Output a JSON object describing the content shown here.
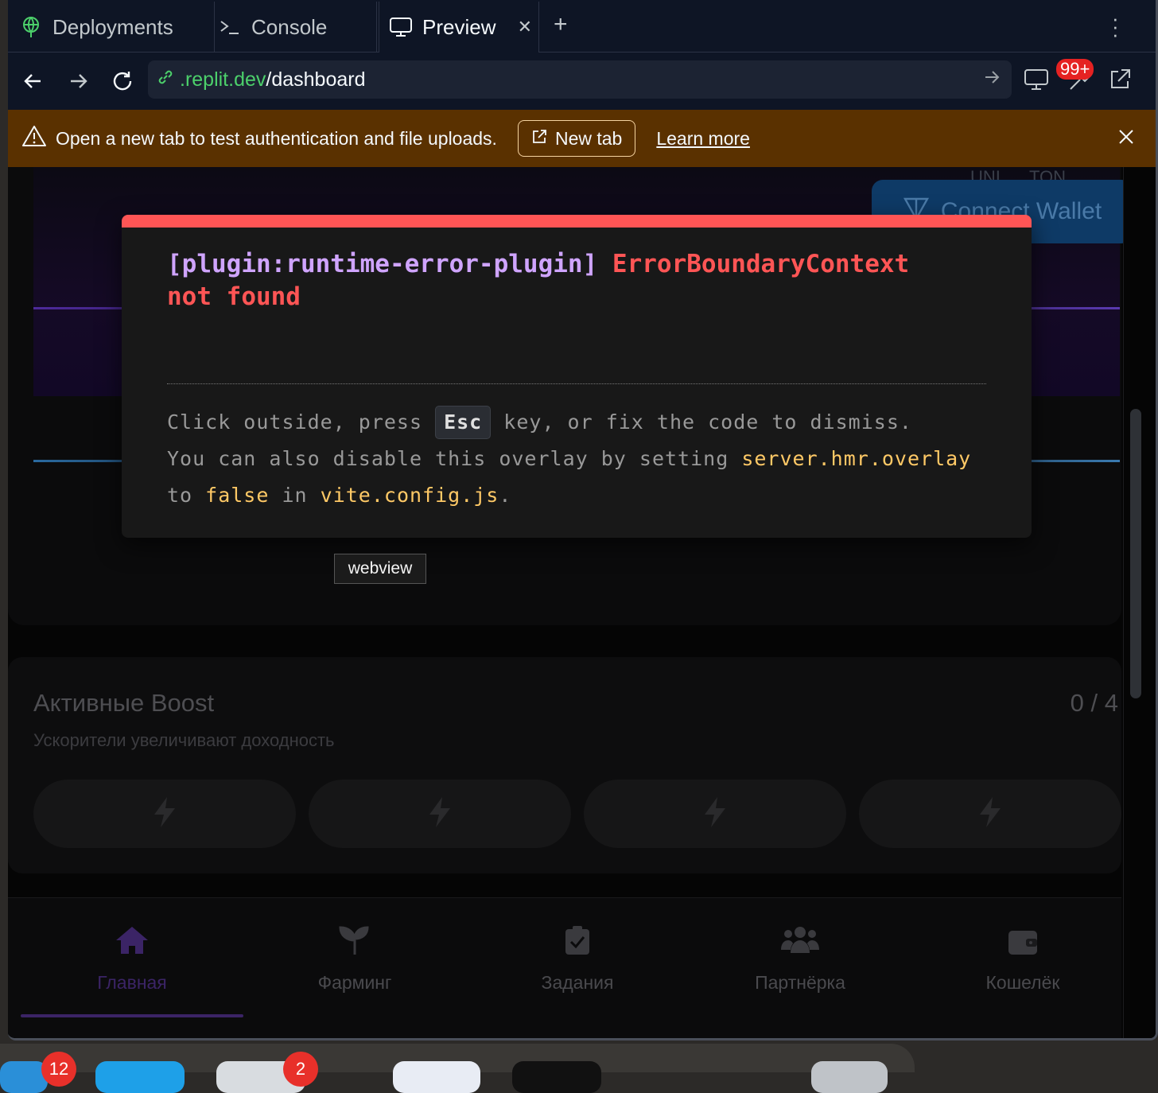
{
  "tabs": [
    {
      "label": "Deployments"
    },
    {
      "label": "Console"
    },
    {
      "label": "Preview"
    }
  ],
  "url": {
    "host": ".replit.dev",
    "path": "/dashboard"
  },
  "notifications_badge": "99+",
  "banner": {
    "message": "Open a new tab to test authentication and file uploads.",
    "new_tab_label": "New tab",
    "learn_more_label": "Learn more"
  },
  "hero": {
    "chips": [
      "UNI",
      "TON"
    ],
    "connect_wallet_label": "Connect Wallet"
  },
  "error_overlay": {
    "plugin": "[plugin:runtime-error-plugin]",
    "message_line1": "ErrorBoundaryContext",
    "message_line2": "not found",
    "tip_part1": "Click outside, press ",
    "tip_key": "Esc",
    "tip_part2": " key, or fix the code to dismiss.",
    "tip_part3": "You can also disable this overlay by setting ",
    "tip_code1": "server.hmr.overlay",
    "tip_part4": "to ",
    "tip_code2": "false",
    "tip_part5": " in ",
    "tip_code3": "vite.config.js",
    "tip_part6": "."
  },
  "tooltip": "webview",
  "boost": {
    "title": "Активные Boost",
    "subtitle": "Ускорители увеличивают доходность",
    "count": "0 / 4"
  },
  "bottom_nav": [
    {
      "label": "Главная",
      "icon": "home-icon",
      "active": true
    },
    {
      "label": "Фарминг",
      "icon": "sprout-icon",
      "active": false
    },
    {
      "label": "Задания",
      "icon": "clipboard-check-icon",
      "active": false
    },
    {
      "label": "Партнёрка",
      "icon": "users-icon",
      "active": false
    },
    {
      "label": "Кошелёк",
      "icon": "wallet-icon",
      "active": false
    }
  ],
  "dock_badges": [
    "12",
    "2"
  ],
  "colors": {
    "error": "#ff5555",
    "plugin": "#cfa4ff",
    "code": "#ffc966",
    "banner": "#5a3100",
    "url_host": "#4cd06b",
    "active_nav": "#3b2466"
  }
}
